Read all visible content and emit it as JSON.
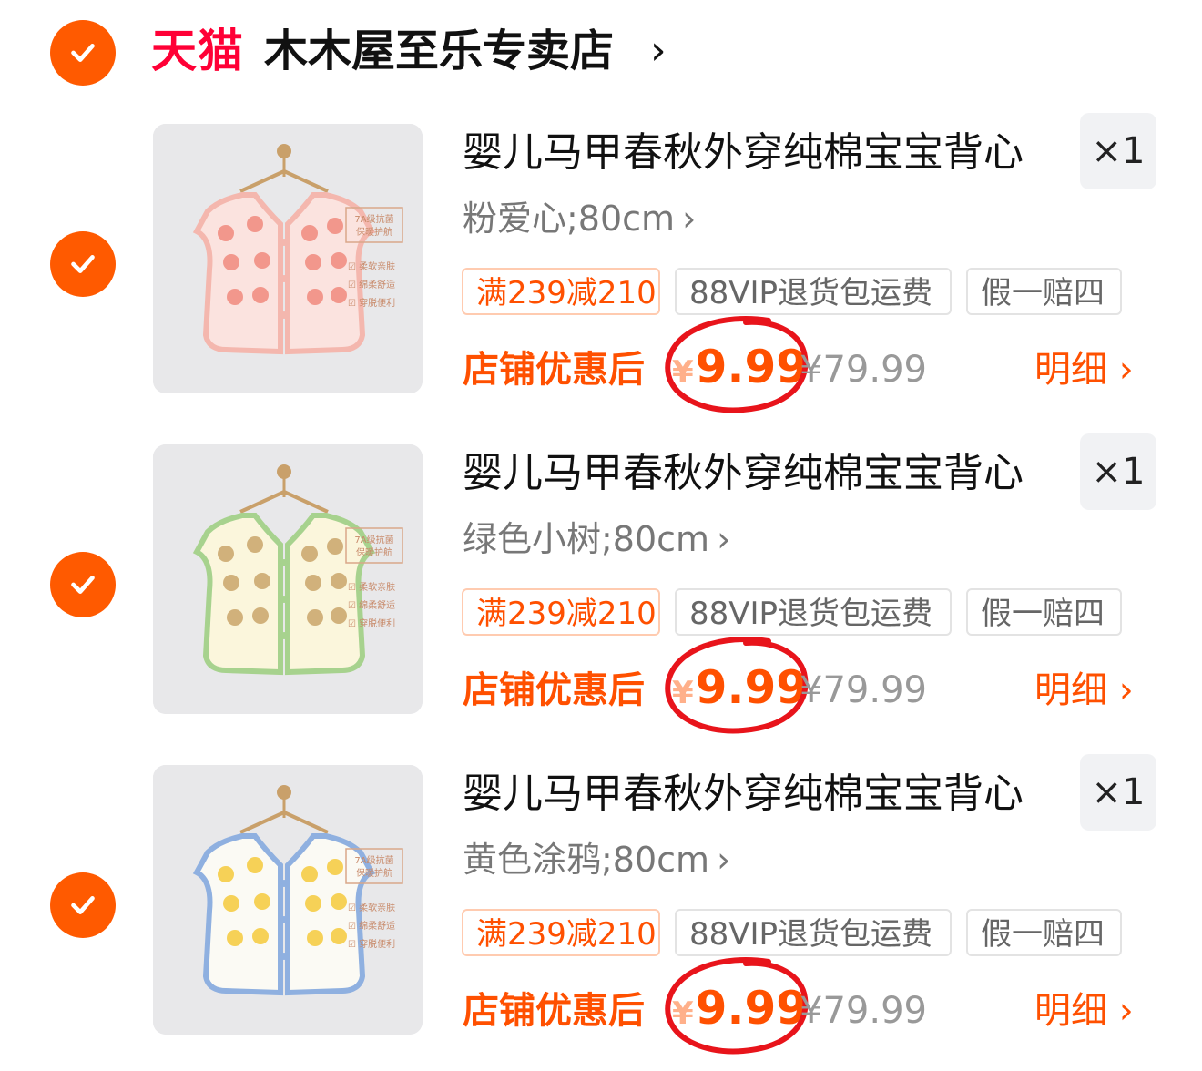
{
  "store": {
    "platform_logo": "天猫",
    "name": "木木屋至乐专卖店",
    "chevron": "›",
    "selected": true
  },
  "colors": {
    "accent": "#ff5000",
    "check": "#ff5a00",
    "tmall_red": "#ff0036",
    "annotation_circle": "#e8141b"
  },
  "items": [
    {
      "title": "婴儿马甲春秋外穿纯棉宝宝背心",
      "quantity": "×1",
      "spec": "粉爱心;80cm",
      "tags": [
        "满239减210",
        "88VIP退货包运费",
        "假一赔四"
      ],
      "after_discount_label": "店铺优惠后",
      "currency": "¥",
      "price": "9.99",
      "original_price": "¥79.99",
      "detail_label": "明细",
      "image": {
        "vest_color": "pink-hearts",
        "label_lines": [
          "7A级抗菌",
          "保暖护航",
          "柔软亲肤",
          "绵柔舒适",
          "穿脱便利"
        ]
      },
      "selected": true
    },
    {
      "title": "婴儿马甲春秋外穿纯棉宝宝背心",
      "quantity": "×1",
      "spec": "绿色小树;80cm",
      "tags": [
        "满239减210",
        "88VIP退货包运费",
        "假一赔四"
      ],
      "after_discount_label": "店铺优惠后",
      "currency": "¥",
      "price": "9.99",
      "original_price": "¥79.99",
      "detail_label": "明细",
      "image": {
        "vest_color": "green-trees",
        "label_lines": [
          "7A级抗菌",
          "保暖护航",
          "柔软亲肤",
          "绵柔舒适",
          "穿脱便利"
        ]
      },
      "selected": true
    },
    {
      "title": "婴儿马甲春秋外穿纯棉宝宝背心",
      "quantity": "×1",
      "spec": "黄色涂鸦;80cm",
      "tags": [
        "满239减210",
        "88VIP退货包运费",
        "假一赔四"
      ],
      "after_discount_label": "店铺优惠后",
      "currency": "¥",
      "price": "9.99",
      "original_price": "¥79.99",
      "detail_label": "明细",
      "image": {
        "vest_color": "yellow-doodle",
        "label_lines": [
          "7A级抗菌",
          "保暖护航",
          "柔软亲肤",
          "绵柔舒适",
          "穿脱便利"
        ]
      },
      "selected": true
    }
  ]
}
